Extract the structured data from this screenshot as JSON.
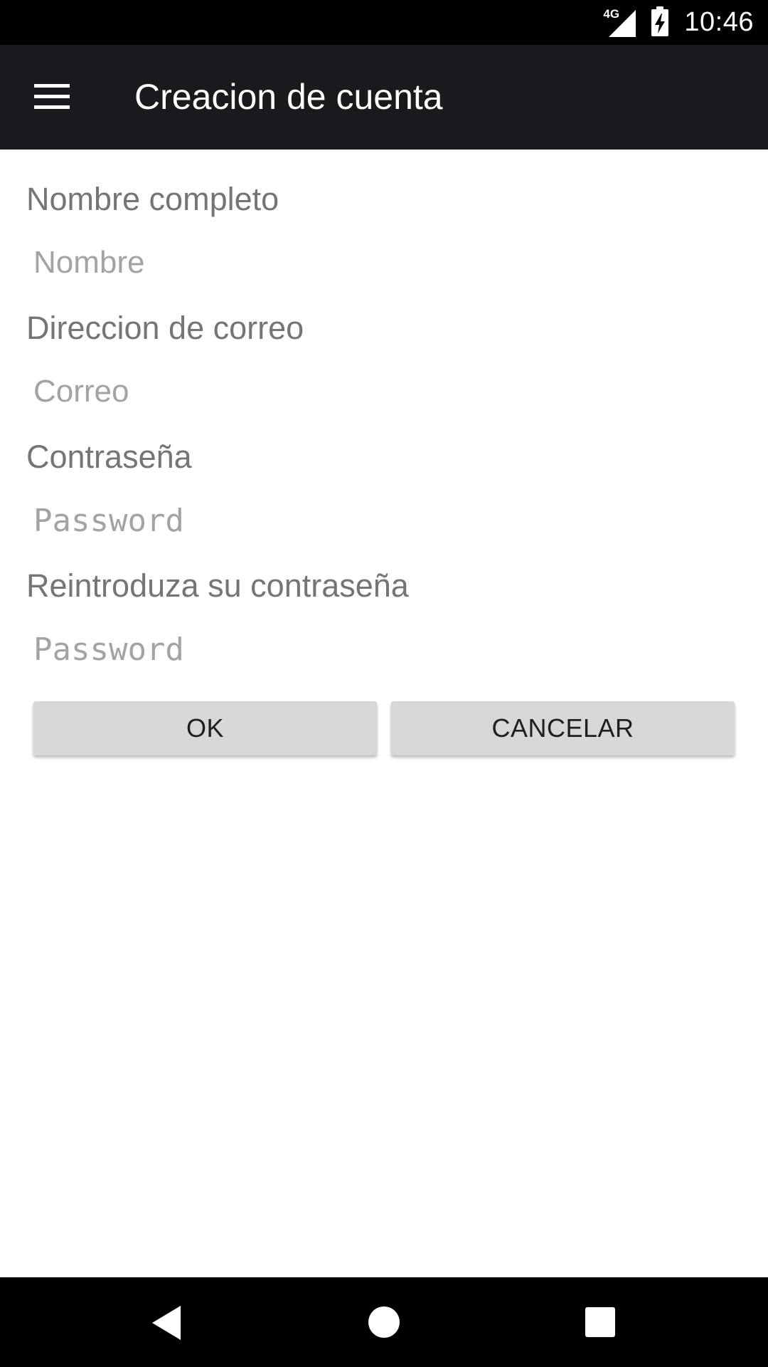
{
  "status_bar": {
    "network": "4G",
    "time": "10:46",
    "icons": [
      "signal-icon",
      "battery-charging-icon"
    ]
  },
  "app_bar": {
    "title": "Creacion de cuenta",
    "menu_icon": "hamburger-menu-icon"
  },
  "form": {
    "name": {
      "label": "Nombre completo",
      "placeholder": "Nombre",
      "value": ""
    },
    "email": {
      "label": "Direccion de correo",
      "placeholder": "Correo",
      "value": ""
    },
    "password": {
      "label": "Contraseña",
      "placeholder": "Password",
      "value": ""
    },
    "password_repeat": {
      "label": "Reintroduza su contraseña",
      "placeholder": "Password",
      "value": ""
    }
  },
  "buttons": {
    "ok_label": "OK",
    "cancel_label": "CANCELAR"
  },
  "nav_bar": {
    "icons": [
      "back-icon",
      "home-icon",
      "recent-apps-icon"
    ]
  },
  "colors": {
    "status_bar": "#000000",
    "app_bar": "#1a191e",
    "button_bg": "#d6d7d7",
    "label_text": "#757575",
    "placeholder_text": "#a3a3a3"
  }
}
